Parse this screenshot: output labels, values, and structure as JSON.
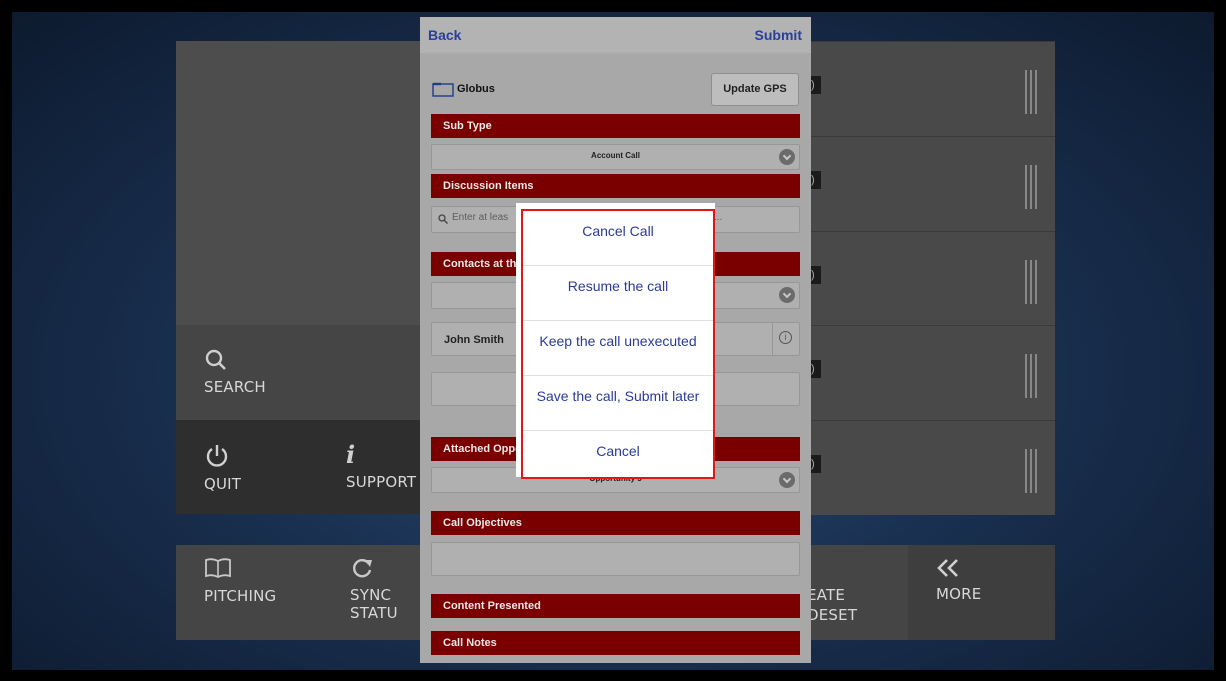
{
  "dashboard": {
    "search_label": "SEARCH",
    "quit_label": "QUIT",
    "support_label": "SUPPORT",
    "pitching_label": "PITCHING",
    "sync_label": "SYNC STATU",
    "create_label_line1": "EATE",
    "create_label_line2": "DESET",
    "more_label": "MORE"
  },
  "form": {
    "back_label": "Back",
    "submit_label": "Submit",
    "account_name": "Globus",
    "update_gps_label": "Update GPS",
    "sections": {
      "sub_type": "Sub Type",
      "discussion_items": "Discussion Items",
      "contacts": "Contacts at th",
      "attached_opp": "Attached Oppo",
      "call_objectives": "Call Objectives",
      "content_presented": "Content Presented",
      "call_notes": "Call Notes"
    },
    "sub_type_value": "Account Call",
    "search_placeholder": "Enter at leas",
    "search_placeholder_tail": "...",
    "contact_name": "John Smith",
    "opportunity_value": "Opportunity 3"
  },
  "modal": {
    "options": [
      "Cancel Call",
      "Resume the call",
      "Keep the call unexecuted",
      "Save the call, Submit later",
      "Cancel"
    ]
  },
  "colors": {
    "section_red": "#7a0000",
    "link_blue": "#2a3f9a",
    "highlight_red": "#e0161a"
  }
}
